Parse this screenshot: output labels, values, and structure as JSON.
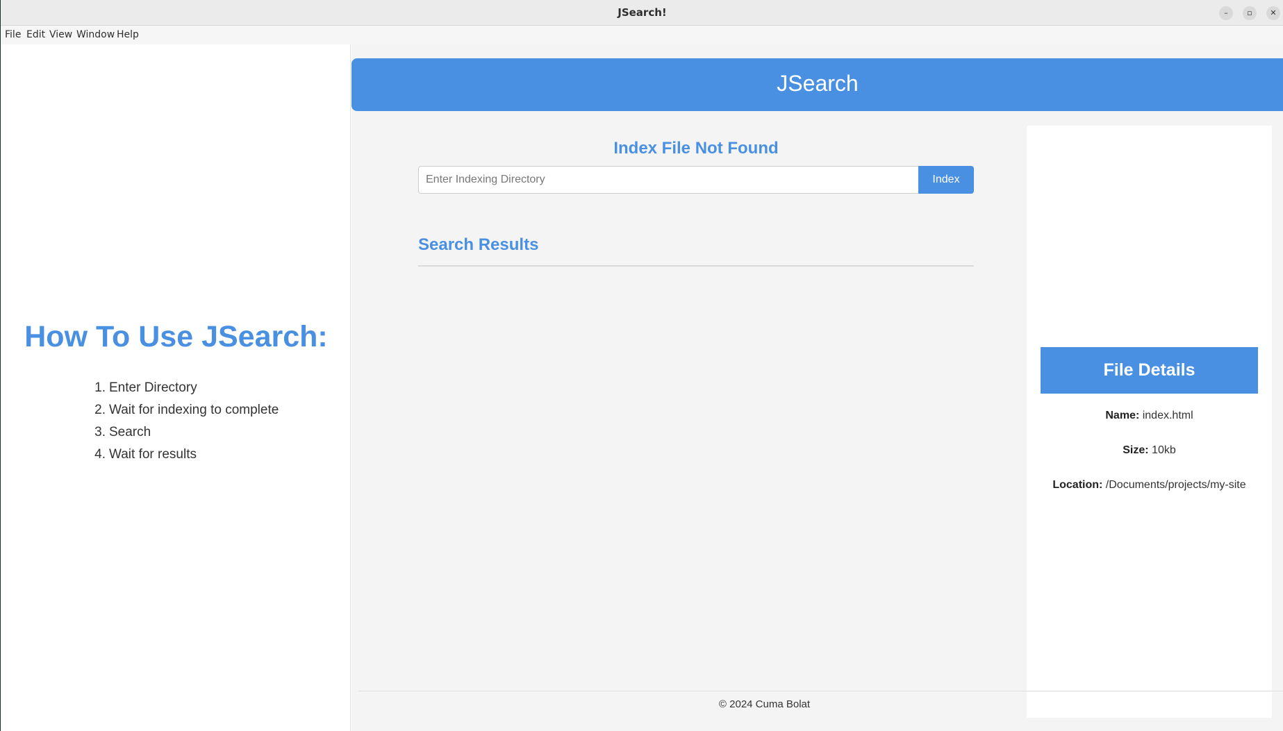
{
  "window": {
    "title": "JSearch!",
    "controls": {
      "minimize": "–",
      "maximize": "▫",
      "close": "✕"
    }
  },
  "menu": [
    "File",
    "Edit",
    "View",
    "Window",
    "Help"
  ],
  "instructions": {
    "title": "How To Use JSearch:",
    "steps": [
      {
        "num": "1.",
        "text": "Enter Directory"
      },
      {
        "num": "2.",
        "text": "Wait for indexing to complete"
      },
      {
        "num": "3.",
        "text": "Search"
      },
      {
        "num": "4.",
        "text": "Wait for results"
      }
    ]
  },
  "header": {
    "title": "JSearch"
  },
  "index": {
    "status": "Index File Not Found",
    "placeholder": "Enter Indexing Directory",
    "value": "",
    "button_label": "Index"
  },
  "results": {
    "title": "Search Results",
    "items": []
  },
  "details": {
    "title": "File Details",
    "name_label": "Name:",
    "name": "index.html",
    "size_label": "Size:",
    "size": "10kb",
    "location_label": "Location:",
    "location": "/Documents/projects/my-site"
  },
  "footer": {
    "text": "© 2024 Cuma Bolat"
  },
  "colors": {
    "accent": "#4a90e2",
    "background": "#f4f4f4",
    "text": "#333333"
  }
}
